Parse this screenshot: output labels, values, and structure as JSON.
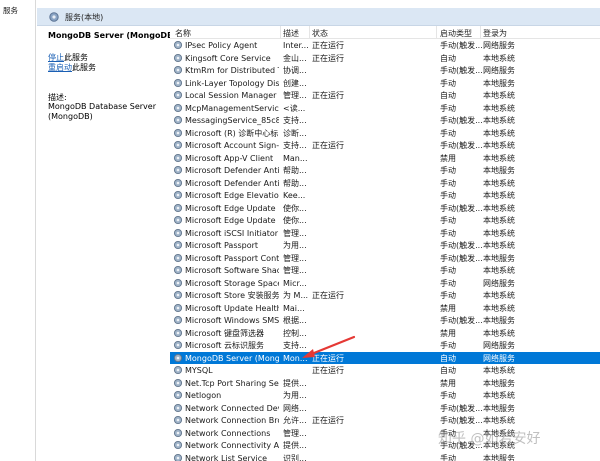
{
  "tree": {
    "item": "服务"
  },
  "window": {
    "title": "服务(本地)"
  },
  "description": {
    "service_name": "MongoDB Server (MongoDB)",
    "stop_link": "停止",
    "stop_suffix": "此服务",
    "restart_link": "重启动",
    "restart_suffix": "此服务",
    "desc_label": "描述:",
    "desc_text": "MongoDB Database Server (MongoDB)"
  },
  "columns": {
    "name": "名称",
    "desc": "描述",
    "status": "状态",
    "startup": "启动类型",
    "logon": "登录为"
  },
  "rows": [
    {
      "name": "IPsec Policy Agent",
      "desc": "Inter...",
      "status": "正在运行",
      "startup": "手动(触发...",
      "logon": "网络服务"
    },
    {
      "name": "Kingsoft Core Service",
      "desc": "金山...",
      "status": "正在运行",
      "startup": "自动",
      "logon": "本地系统"
    },
    {
      "name": "KtmRm for Distributed Tr...",
      "desc": "协调...",
      "status": "",
      "startup": "手动(触发...",
      "logon": "网络服务"
    },
    {
      "name": "Link-Layer Topology Disc...",
      "desc": "创建...",
      "status": "",
      "startup": "手动",
      "logon": "本地服务"
    },
    {
      "name": "Local Session Manager",
      "desc": "管理...",
      "status": "正在运行",
      "startup": "自动",
      "logon": "本地系统"
    },
    {
      "name": "McpManagementService",
      "desc": "<读...",
      "status": "",
      "startup": "手动",
      "logon": "本地系统"
    },
    {
      "name": "MessagingService_85c8d",
      "desc": "支持...",
      "status": "",
      "startup": "手动(触发...",
      "logon": "本地系统"
    },
    {
      "name": "Microsoft (R) 诊断中心标...",
      "desc": "诊断...",
      "status": "",
      "startup": "手动",
      "logon": "本地系统"
    },
    {
      "name": "Microsoft Account Sign-i...",
      "desc": "支持...",
      "status": "正在运行",
      "startup": "手动(触发...",
      "logon": "本地系统"
    },
    {
      "name": "Microsoft App-V Client",
      "desc": "Man...",
      "status": "",
      "startup": "禁用",
      "logon": "本地系统"
    },
    {
      "name": "Microsoft Defender Antiv...",
      "desc": "帮助...",
      "status": "",
      "startup": "手动",
      "logon": "本地服务"
    },
    {
      "name": "Microsoft Defender Antiv...",
      "desc": "帮助...",
      "status": "",
      "startup": "手动",
      "logon": "本地系统"
    },
    {
      "name": "Microsoft Edge Elevation...",
      "desc": "Kee...",
      "status": "",
      "startup": "手动",
      "logon": "本地系统"
    },
    {
      "name": "Microsoft Edge Update ...",
      "desc": "使你...",
      "status": "",
      "startup": "手动(触发...",
      "logon": "本地系统"
    },
    {
      "name": "Microsoft Edge Update ...",
      "desc": "使你...",
      "status": "",
      "startup": "手动",
      "logon": "本地系统"
    },
    {
      "name": "Microsoft iSCSI Initiator ...",
      "desc": "管理...",
      "status": "",
      "startup": "手动",
      "logon": "本地系统"
    },
    {
      "name": "Microsoft Passport",
      "desc": "为用...",
      "status": "",
      "startup": "手动(触发...",
      "logon": "本地系统"
    },
    {
      "name": "Microsoft Passport Cont...",
      "desc": "管理...",
      "status": "",
      "startup": "手动(触发...",
      "logon": "本地服务"
    },
    {
      "name": "Microsoft Software Shad...",
      "desc": "管理...",
      "status": "",
      "startup": "手动",
      "logon": "本地系统"
    },
    {
      "name": "Microsoft Storage Space...",
      "desc": "Micr...",
      "status": "",
      "startup": "手动",
      "logon": "网络服务"
    },
    {
      "name": "Microsoft Store 安装服务",
      "desc": "为 M...",
      "status": "正在运行",
      "startup": "手动",
      "logon": "本地系统"
    },
    {
      "name": "Microsoft Update Health...",
      "desc": "Mai...",
      "status": "",
      "startup": "禁用",
      "logon": "本地系统"
    },
    {
      "name": "Microsoft Windows SMS ...",
      "desc": "根据...",
      "status": "",
      "startup": "手动(触发...",
      "logon": "本地服务"
    },
    {
      "name": "Microsoft 键盘筛选器",
      "desc": "控制...",
      "status": "",
      "startup": "禁用",
      "logon": "本地系统"
    },
    {
      "name": "Microsoft 云标识服务",
      "desc": "支持...",
      "status": "",
      "startup": "手动",
      "logon": "网络服务"
    },
    {
      "name": "MongoDB Server (Mong...",
      "desc": "Mon...",
      "status": "正在运行",
      "startup": "自动",
      "logon": "网络服务"
    },
    {
      "name": "MYSQL",
      "desc": "",
      "status": "正在运行",
      "startup": "自动",
      "logon": "本地系统"
    },
    {
      "name": "Net.Tcp Port Sharing Ser...",
      "desc": "提供...",
      "status": "",
      "startup": "禁用",
      "logon": "本地服务"
    },
    {
      "name": "Netlogon",
      "desc": "为用...",
      "status": "",
      "startup": "手动",
      "logon": "本地系统"
    },
    {
      "name": "Network Connected Devi...",
      "desc": "网络...",
      "status": "",
      "startup": "手动(触发...",
      "logon": "本地服务"
    },
    {
      "name": "Network Connection Bro...",
      "desc": "允许...",
      "status": "正在运行",
      "startup": "手动(触发...",
      "logon": "本地系统"
    },
    {
      "name": "Network Connections",
      "desc": "管理...",
      "status": "",
      "startup": "手动",
      "logon": "本地系统"
    },
    {
      "name": "Network Connectivity Ass...",
      "desc": "提供...",
      "status": "",
      "startup": "手动(触发...",
      "logon": "本地系统"
    },
    {
      "name": "Network List Service",
      "desc": "识别...",
      "status": "",
      "startup": "手动",
      "logon": "本地服务"
    }
  ],
  "selected_row_index": 25,
  "colors": {
    "selection": "#0078d7",
    "link": "#1a5fb4",
    "arrow": "#e53935"
  },
  "watermark": "知乎 @如若安好"
}
